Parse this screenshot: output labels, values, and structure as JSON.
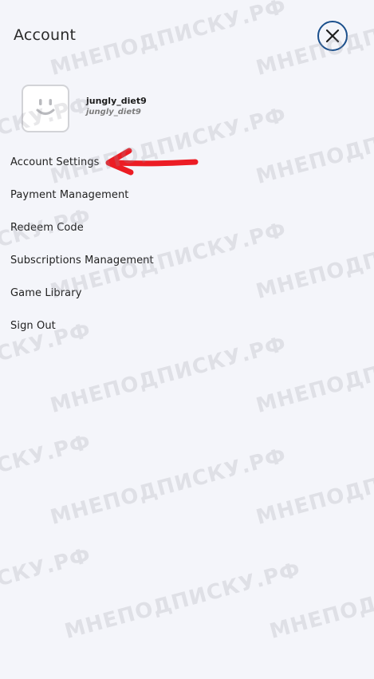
{
  "header": {
    "title": "Account"
  },
  "close_button": {
    "icon": "close-icon"
  },
  "profile": {
    "avatar_icon": "smiley-face-icon",
    "username": "jungly_diet9",
    "handle": "jungly_diet9"
  },
  "menu": {
    "items": [
      {
        "label": "Account Settings"
      },
      {
        "label": "Payment Management"
      },
      {
        "label": "Redeem Code"
      },
      {
        "label": "Subscriptions Management"
      },
      {
        "label": "Game Library"
      },
      {
        "label": "Sign Out"
      }
    ]
  },
  "annotation": {
    "arrow_icon": "red-arrow-annotation",
    "arrow_color": "#ec1c24"
  },
  "watermark": {
    "text": "МНЕПОДПИСКУ.РФ"
  },
  "colors": {
    "background": "#f4f5fa",
    "close_ring": "#1a4f8c"
  }
}
